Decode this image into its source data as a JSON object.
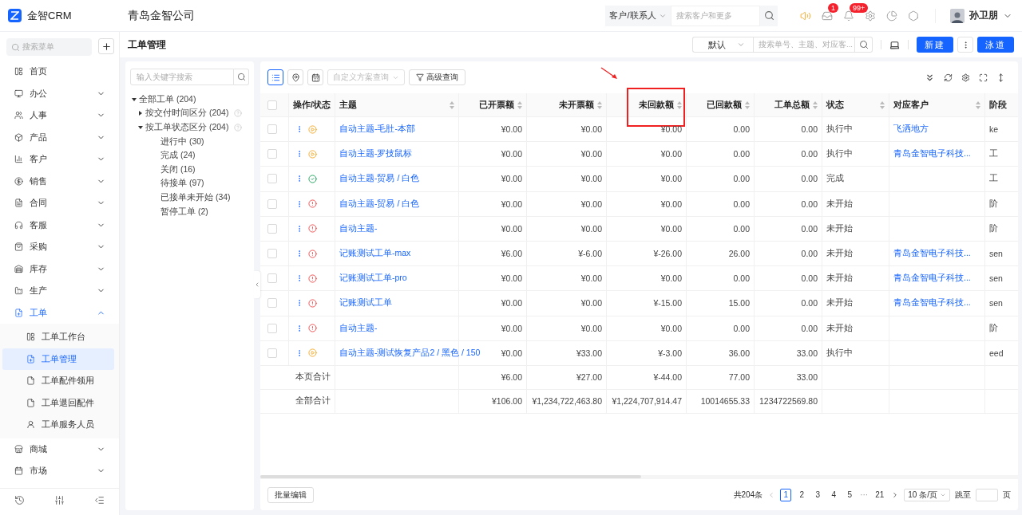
{
  "app": {
    "name": "金智CRM",
    "company": "青岛金智公司"
  },
  "topbar": {
    "search_scope": "客户/联系人",
    "search_placeholder": "搜索客户和更多",
    "icons": [
      {
        "kind": "speaker"
      },
      {
        "kind": "inbox",
        "badge": "1"
      },
      {
        "kind": "bell",
        "badge": "99+"
      },
      {
        "kind": "settings"
      },
      {
        "kind": "chart"
      },
      {
        "kind": "cube"
      }
    ],
    "user": {
      "name": "孙卫朋"
    }
  },
  "sidebar": {
    "search_placeholder": "搜索菜单",
    "items": [
      {
        "label": "首页",
        "kind": "link"
      },
      {
        "label": "办公",
        "kind": "group",
        "expanded": false
      },
      {
        "label": "人事",
        "kind": "group",
        "expanded": false
      },
      {
        "label": "产品",
        "kind": "group",
        "expanded": false
      },
      {
        "label": "客户",
        "kind": "group",
        "expanded": false
      },
      {
        "label": "销售",
        "kind": "group",
        "expanded": false
      },
      {
        "label": "合同",
        "kind": "group",
        "expanded": false
      },
      {
        "label": "客服",
        "kind": "group",
        "expanded": false
      },
      {
        "label": "采购",
        "kind": "group",
        "expanded": false
      },
      {
        "label": "库存",
        "kind": "group",
        "expanded": false
      },
      {
        "label": "生产",
        "kind": "group",
        "expanded": false
      },
      {
        "label": "工单",
        "kind": "group",
        "expanded": true,
        "children": [
          {
            "label": "工单工作台",
            "selected": false
          },
          {
            "label": "工单管理",
            "selected": true
          },
          {
            "label": "工单配件领用",
            "selected": false
          },
          {
            "label": "工单退回配件",
            "selected": false
          },
          {
            "label": "工单服务人员",
            "selected": false
          }
        ]
      },
      {
        "label": "商城",
        "kind": "group",
        "expanded": false
      },
      {
        "label": "市场",
        "kind": "group",
        "expanded": false
      }
    ]
  },
  "page": {
    "title": "工单管理",
    "view_select": "默认",
    "search_placeholder": "搜索单号、主题、对应客...",
    "buttons": [
      "新建",
      "泳道"
    ]
  },
  "tree": {
    "search_placeholder": "输入关键字搜索",
    "nodes": [
      {
        "label": "全部工单 (204)",
        "expanded": true,
        "help": false,
        "children": [
          {
            "label": "按交付时间区分 (204)",
            "expanded": false,
            "help": true
          },
          {
            "label": "按工单状态区分 (204)",
            "expanded": true,
            "help": true,
            "children": [
              {
                "label": "进行中 (30)"
              },
              {
                "label": "完成 (24)"
              },
              {
                "label": "关闭 (16)"
              },
              {
                "label": "待接单 (97)"
              },
              {
                "label": "已接单未开始 (34)"
              },
              {
                "label": "暂停工单 (2)"
              }
            ]
          }
        ]
      }
    ]
  },
  "toolbar": {
    "views": [
      {
        "kind": "list",
        "selected": true
      },
      {
        "kind": "map",
        "selected": false
      },
      {
        "kind": "calendar",
        "selected": false
      }
    ],
    "scheme_placeholder": "自定义方案查询",
    "filter": "高级查询"
  },
  "table": {
    "all_checked": false,
    "columns": [
      {
        "label": "操作/状态",
        "sortable": false,
        "highlighted": false
      },
      {
        "label": "主题",
        "sortable": true,
        "highlighted": false
      },
      {
        "label": "已开票额",
        "sortable": true,
        "highlighted": false
      },
      {
        "label": "未开票额",
        "sortable": true,
        "highlighted": false
      },
      {
        "label": "未回款额",
        "sortable": true,
        "highlighted": true
      },
      {
        "label": "已回款额",
        "sortable": true,
        "highlighted": false
      },
      {
        "label": "工单总额",
        "sortable": true,
        "highlighted": false
      },
      {
        "label": "状态",
        "sortable": true,
        "highlighted": false
      },
      {
        "label": "对应客户",
        "sortable": true,
        "highlighted": false
      },
      {
        "label": "阶段",
        "sortable": false,
        "highlighted": false
      }
    ],
    "rows": [
      {
        "checked": false,
        "kind": "running",
        "subject": "自动主题-毛肚-本部",
        "invoiced": "¥0.00",
        "uninvoiced": "¥0.00",
        "unpaid": "¥0.00",
        "paid": "0.00",
        "total": "0.00",
        "state": "执行中",
        "customer": "飞洒地方",
        "stage": "ke"
      },
      {
        "checked": false,
        "kind": "running",
        "subject": "自动主题-罗技鼠标",
        "invoiced": "¥0.00",
        "uninvoiced": "¥0.00",
        "unpaid": "¥0.00",
        "paid": "0.00",
        "total": "0.00",
        "state": "执行中",
        "customer": "青岛金智电子科技...",
        "stage": "工"
      },
      {
        "checked": false,
        "kind": "done",
        "subject": "自动主题-贸易 / 白色",
        "invoiced": "¥0.00",
        "uninvoiced": "¥0.00",
        "unpaid": "¥0.00",
        "paid": "0.00",
        "total": "0.00",
        "state": "完成",
        "stage": "工"
      },
      {
        "checked": false,
        "kind": "pending",
        "subject": "自动主题-贸易 / 白色",
        "invoiced": "¥0.00",
        "uninvoiced": "¥0.00",
        "unpaid": "¥0.00",
        "paid": "0.00",
        "total": "0.00",
        "state": "未开始",
        "stage": "阶"
      },
      {
        "checked": false,
        "kind": "pending",
        "subject": "自动主题-",
        "invoiced": "¥0.00",
        "uninvoiced": "¥0.00",
        "unpaid": "¥0.00",
        "paid": "0.00",
        "total": "0.00",
        "state": "未开始",
        "stage": "阶"
      },
      {
        "checked": false,
        "kind": "pending",
        "subject": "记账测试工单-max",
        "invoiced": "¥6.00",
        "uninvoiced": "¥-6.00",
        "unpaid": "¥-26.00",
        "paid": "26.00",
        "total": "0.00",
        "state": "未开始",
        "customer": "青岛金智电子科技...",
        "stage": "sen"
      },
      {
        "checked": false,
        "kind": "pending",
        "subject": "记账测试工单-pro",
        "invoiced": "¥0.00",
        "uninvoiced": "¥0.00",
        "unpaid": "¥0.00",
        "paid": "0.00",
        "total": "0.00",
        "state": "未开始",
        "customer": "青岛金智电子科技...",
        "stage": "sen"
      },
      {
        "checked": false,
        "kind": "pending",
        "subject": "记账测试工单",
        "invoiced": "¥0.00",
        "uninvoiced": "¥0.00",
        "unpaid": "¥-15.00",
        "paid": "15.00",
        "total": "0.00",
        "state": "未开始",
        "customer": "青岛金智电子科技...",
        "stage": "sen"
      },
      {
        "checked": false,
        "kind": "pending",
        "subject": "自动主题-",
        "invoiced": "¥0.00",
        "uninvoiced": "¥0.00",
        "unpaid": "¥0.00",
        "paid": "0.00",
        "total": "0.00",
        "state": "未开始",
        "stage": "阶"
      },
      {
        "checked": false,
        "kind": "running",
        "subject": "自动主题-测试恢复产品2 / 黑色 / 150",
        "invoiced": "¥0.00",
        "uninvoiced": "¥33.00",
        "unpaid": "¥-3.00",
        "paid": "36.00",
        "total": "33.00",
        "state": "执行中",
        "stage": "eed"
      }
    ],
    "summaries": [
      {
        "label": "本页合计",
        "invoiced": "¥6.00",
        "uninvoiced": "¥27.00",
        "unpaid": "¥-44.00",
        "paid": "77.00",
        "total": "33.00"
      },
      {
        "label": "全部合计",
        "invoiced": "¥106.00",
        "uninvoiced": "¥1,234,722,463.80",
        "unpaid": "¥1,224,707,914.47",
        "paid": "10014655.33",
        "total": "1234722569.80"
      }
    ]
  },
  "footer": {
    "batch_button": "批量编辑",
    "total": "共204条",
    "pages": [
      {
        "kind": "page",
        "label": "1",
        "selected": true
      },
      {
        "kind": "page",
        "label": "2",
        "selected": false
      },
      {
        "kind": "page",
        "label": "3",
        "selected": false
      },
      {
        "kind": "page",
        "label": "4",
        "selected": false
      },
      {
        "kind": "page",
        "label": "5",
        "selected": false
      },
      {
        "kind": "ellipsis",
        "label": "···",
        "selected": false
      },
      {
        "kind": "page",
        "label": "21",
        "selected": false
      }
    ],
    "page_size": "10 条/页",
    "jump_label": "跳至",
    "page_suffix": "页"
  }
}
